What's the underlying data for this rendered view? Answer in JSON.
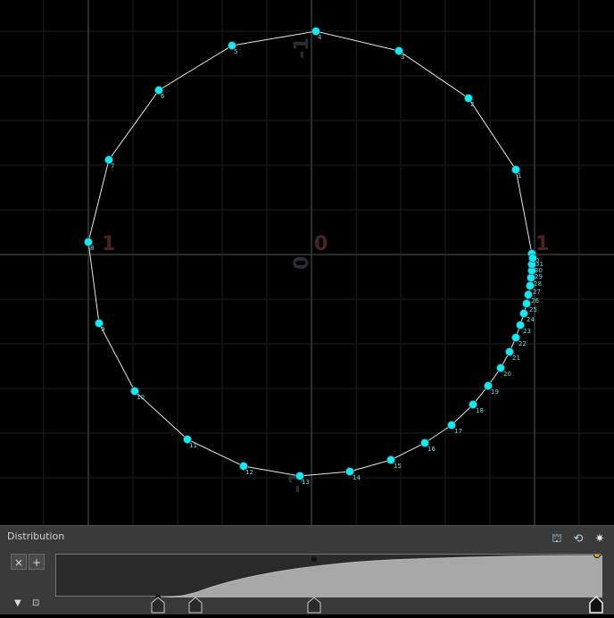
{
  "viewport": {
    "axis_labels": {
      "neg_one_left": "1",
      "pos_one_right": "1",
      "zero_top": "0",
      "zero_rot": "0",
      "neg_one_top": "-1",
      "neg_one_bottom": "-1"
    },
    "point_labels": [
      "0",
      "1",
      "2",
      "3",
      "4",
      "5",
      "6",
      "7",
      "8",
      "9",
      "10",
      "11",
      "12",
      "13",
      "14",
      "15",
      "16",
      "17",
      "18",
      "19",
      "20",
      "21",
      "22",
      "23",
      "24",
      "25",
      "26",
      "27",
      "28",
      "29",
      "30",
      "31"
    ],
    "colors": {
      "point": "#1ee6f0",
      "line": "#e6e6e6",
      "grid": "#2a2a2a",
      "label": "#6fd6e0"
    }
  },
  "panel": {
    "title": "Distribution",
    "icons": [
      "graph-icon",
      "graph-reset-icon",
      "gear-icon"
    ],
    "remove_label": "×",
    "add_label": "+",
    "collapse_label": "▼",
    "bottom_icon_label": "⊡"
  }
}
